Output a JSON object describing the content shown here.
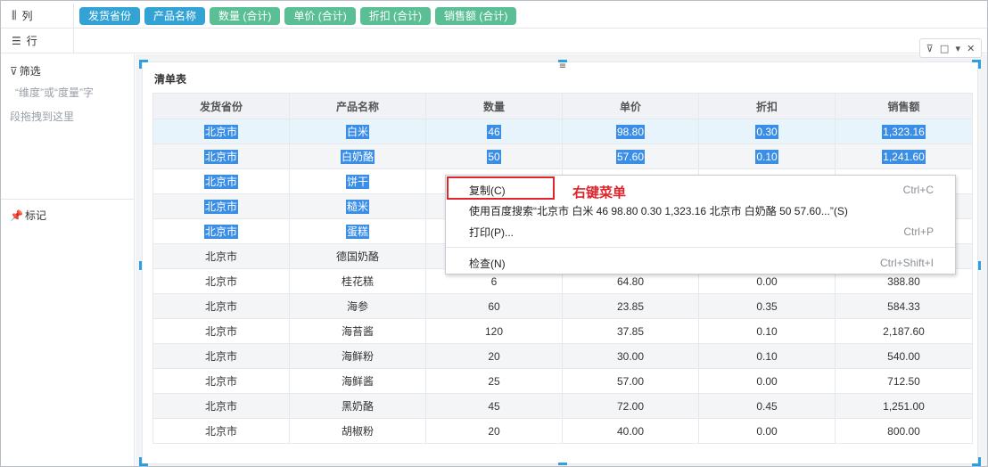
{
  "shelves": {
    "columns_label": "列",
    "rows_label": "行",
    "column_fields": [
      {
        "label": "发货省份",
        "kind": "dimension"
      },
      {
        "label": "产品名称",
        "kind": "dimension"
      },
      {
        "label": "数量 (合计)",
        "kind": "measure"
      },
      {
        "label": "单价 (合计)",
        "kind": "measure"
      },
      {
        "label": "折扣 (合计)",
        "kind": "measure"
      },
      {
        "label": "销售额 (合计)",
        "kind": "measure"
      }
    ]
  },
  "sidebar": {
    "filter_label": "筛选",
    "filter_hint_line1": "“维度”或“度量”字",
    "filter_hint_line2": "段拖拽到这里",
    "mark_label": "标记"
  },
  "widget": {
    "title": "清单表",
    "tools": [
      "filter-icon",
      "maximize-icon",
      "dropdown-icon",
      "close-icon"
    ]
  },
  "table": {
    "headers": [
      "发货省份",
      "产品名称",
      "数量",
      "单价",
      "折扣",
      "销售额"
    ],
    "rows": [
      [
        "北京市",
        "白米",
        "46",
        "98.80",
        "0.30",
        "1,323.16"
      ],
      [
        "北京市",
        "白奶酪",
        "50",
        "57.60",
        "0.10",
        "1,241.60"
      ],
      [
        "北京市",
        "饼干",
        "",
        "",
        "",
        ""
      ],
      [
        "北京市",
        "糙米",
        "",
        "",
        "",
        ""
      ],
      [
        "北京市",
        "蛋糕",
        "",
        "",
        "",
        ""
      ],
      [
        "北京市",
        "德国奶酪",
        "",
        "",
        "",
        ""
      ],
      [
        "北京市",
        "桂花糕",
        "6",
        "64.80",
        "0.00",
        "388.80"
      ],
      [
        "北京市",
        "海参",
        "60",
        "23.85",
        "0.35",
        "584.33"
      ],
      [
        "北京市",
        "海苔酱",
        "120",
        "37.85",
        "0.10",
        "2,187.60"
      ],
      [
        "北京市",
        "海鲜粉",
        "20",
        "30.00",
        "0.10",
        "540.00"
      ],
      [
        "北京市",
        "海鲜酱",
        "25",
        "57.00",
        "0.00",
        "712.50"
      ],
      [
        "北京市",
        "黑奶酪",
        "45",
        "72.00",
        "0.45",
        "1,251.00"
      ],
      [
        "北京市",
        "胡椒粉",
        "20",
        "40.00",
        "0.00",
        "800.00"
      ]
    ],
    "selected_rows": 5
  },
  "context_menu": {
    "items": [
      {
        "label": "复制(C)",
        "shortcut": "Ctrl+C"
      },
      {
        "label": "使用百度搜索“北京市 白米 46 98.80 0.30 1,323.16 北京市 白奶酪 50 57.60...”(S)",
        "shortcut": ""
      },
      {
        "label": "打印(P)...",
        "shortcut": "Ctrl+P"
      },
      {
        "label": "检查(N)",
        "shortcut": "Ctrl+Shift+I"
      }
    ],
    "annotation": "右键菜单"
  },
  "colors": {
    "dimension_pill": "#33a3d6",
    "measure_pill": "#5bbf96",
    "selection": "#3a8ee6",
    "annotation": "#e0242b"
  }
}
